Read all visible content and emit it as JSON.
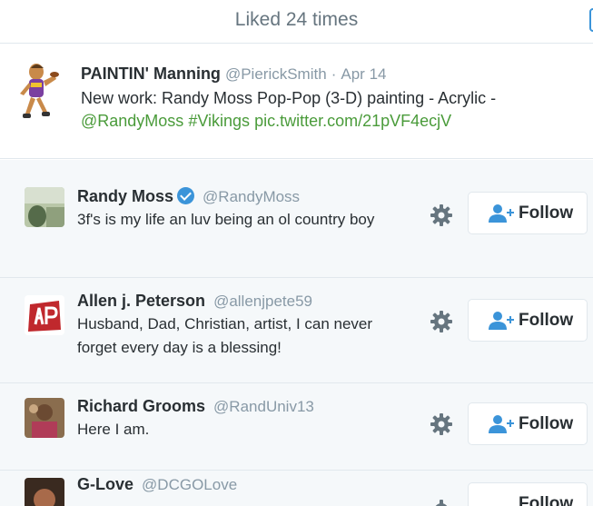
{
  "modal": {
    "title": "Liked 24 times"
  },
  "tweet": {
    "name": "PAINTIN' Manning",
    "handle": "@PierickSmith",
    "separator": "·",
    "date": "Apr 14",
    "text": "New work: Randy Moss Pop-Pop (3-D) painting - Acrylic -",
    "mention": "@RandyMoss",
    "hashtag": "#Vikings",
    "pic_link": "pic.twitter.com/21pVF4ecjV"
  },
  "users": [
    {
      "name": "Randy Moss",
      "verified": true,
      "handle": "@RandyMoss",
      "bio": "3f's is my life an luv being an ol country boy",
      "follow_label": "Follow"
    },
    {
      "name": "Allen j. Peterson",
      "verified": false,
      "handle": "@allenjpete59",
      "bio": "Husband, Dad, Christian, artist, I can never forget every day is a blessing!",
      "follow_label": "Follow"
    },
    {
      "name": "Richard Grooms",
      "verified": false,
      "handle": "@RandUniv13",
      "bio": "Here I am.",
      "follow_label": "Follow"
    },
    {
      "name": "G-Love",
      "verified": false,
      "handle": "@DCGOLove",
      "bio": "",
      "follow_label": "Follow"
    }
  ],
  "colors": {
    "link_green": "#4a9b3a",
    "verified_blue": "#3b94d9",
    "muted": "#8899a6"
  }
}
